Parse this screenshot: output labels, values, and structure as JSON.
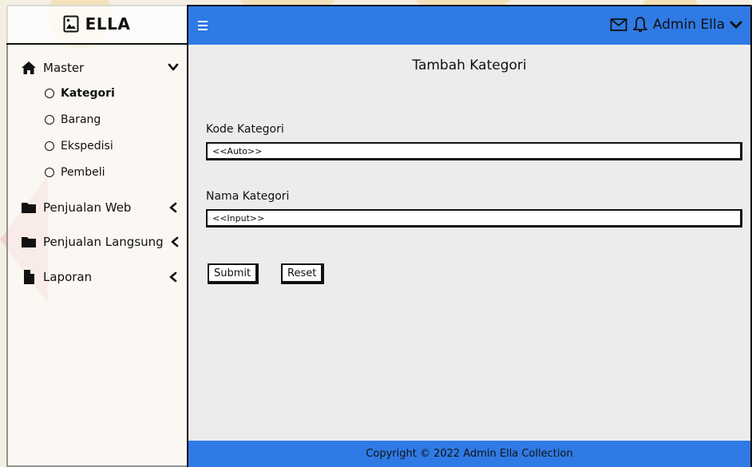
{
  "brand": {
    "title": "ELLA"
  },
  "sidebar": {
    "items": [
      {
        "label": "Master",
        "icon": "home-icon",
        "chevron": "down"
      },
      {
        "label": "Penjualan Web",
        "icon": "folder-icon",
        "chevron": "left"
      },
      {
        "label": "Penjualan Langsung",
        "icon": "folder-icon",
        "chevron": "left"
      },
      {
        "label": "Laporan",
        "icon": "file-icon",
        "chevron": "left"
      }
    ],
    "submenu": [
      {
        "label": "Kategori",
        "active": true
      },
      {
        "label": "Barang",
        "active": false
      },
      {
        "label": "Ekspedisi",
        "active": false
      },
      {
        "label": "Pembeli",
        "active": false
      }
    ]
  },
  "header": {
    "user_name": "Admin Ella",
    "icons": [
      "menu-icon",
      "mail-icon",
      "bell-icon",
      "chevron-down-icon"
    ]
  },
  "main": {
    "title": "Tambah Kategori",
    "fields": [
      {
        "label": "Kode Kategori",
        "value": "<<Auto>>"
      },
      {
        "label": "Nama Kategori",
        "value": "<<Input>>"
      }
    ],
    "buttons": {
      "submit": "Submit",
      "reset": "Reset"
    }
  },
  "footer": {
    "text": "Copyright © 2022 Admin Ella Collection"
  },
  "colors": {
    "accent": "#2f7ae5",
    "content_bg": "#ececec",
    "border": "#111111"
  }
}
